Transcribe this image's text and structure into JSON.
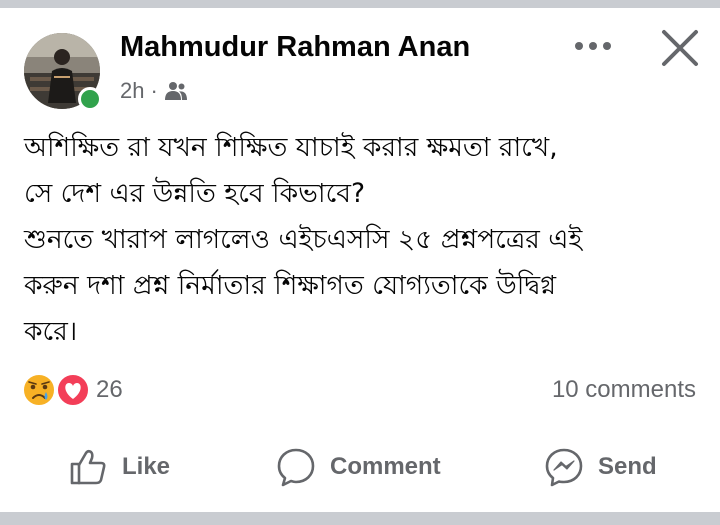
{
  "post": {
    "author": "Mahmudur Rahman Anan",
    "time": "2h",
    "separator": "·",
    "audience_icon": "friends-icon",
    "lines": [
      "অশিক্ষিত রা যখন শিক্ষিত যাচাই করার ক্ষমতা রাখে,",
      "সে দেশ এর উন্নতি হবে কিভাবে?",
      "শুনতে খারাপ লাগলেও এইচএসসি ২৫ প্রশ্নপত্রের এই",
      "করুন দশা প্রশ্ন নির্মাতার শিক্ষাগত যোগ্যতাকে উদ্বিগ্ন",
      "করে।"
    ],
    "reaction_icons": [
      "sad-emoji-icon",
      "love-heart-icon"
    ],
    "reaction_count": "26",
    "comments_count": "10 comments"
  },
  "actions": {
    "like": "Like",
    "comment": "Comment",
    "send": "Send"
  },
  "colors": {
    "text": "#050505",
    "secondary": "#65676b",
    "online": "#31a24c",
    "love": "#f33e58",
    "divider": "#c9ccd1"
  }
}
